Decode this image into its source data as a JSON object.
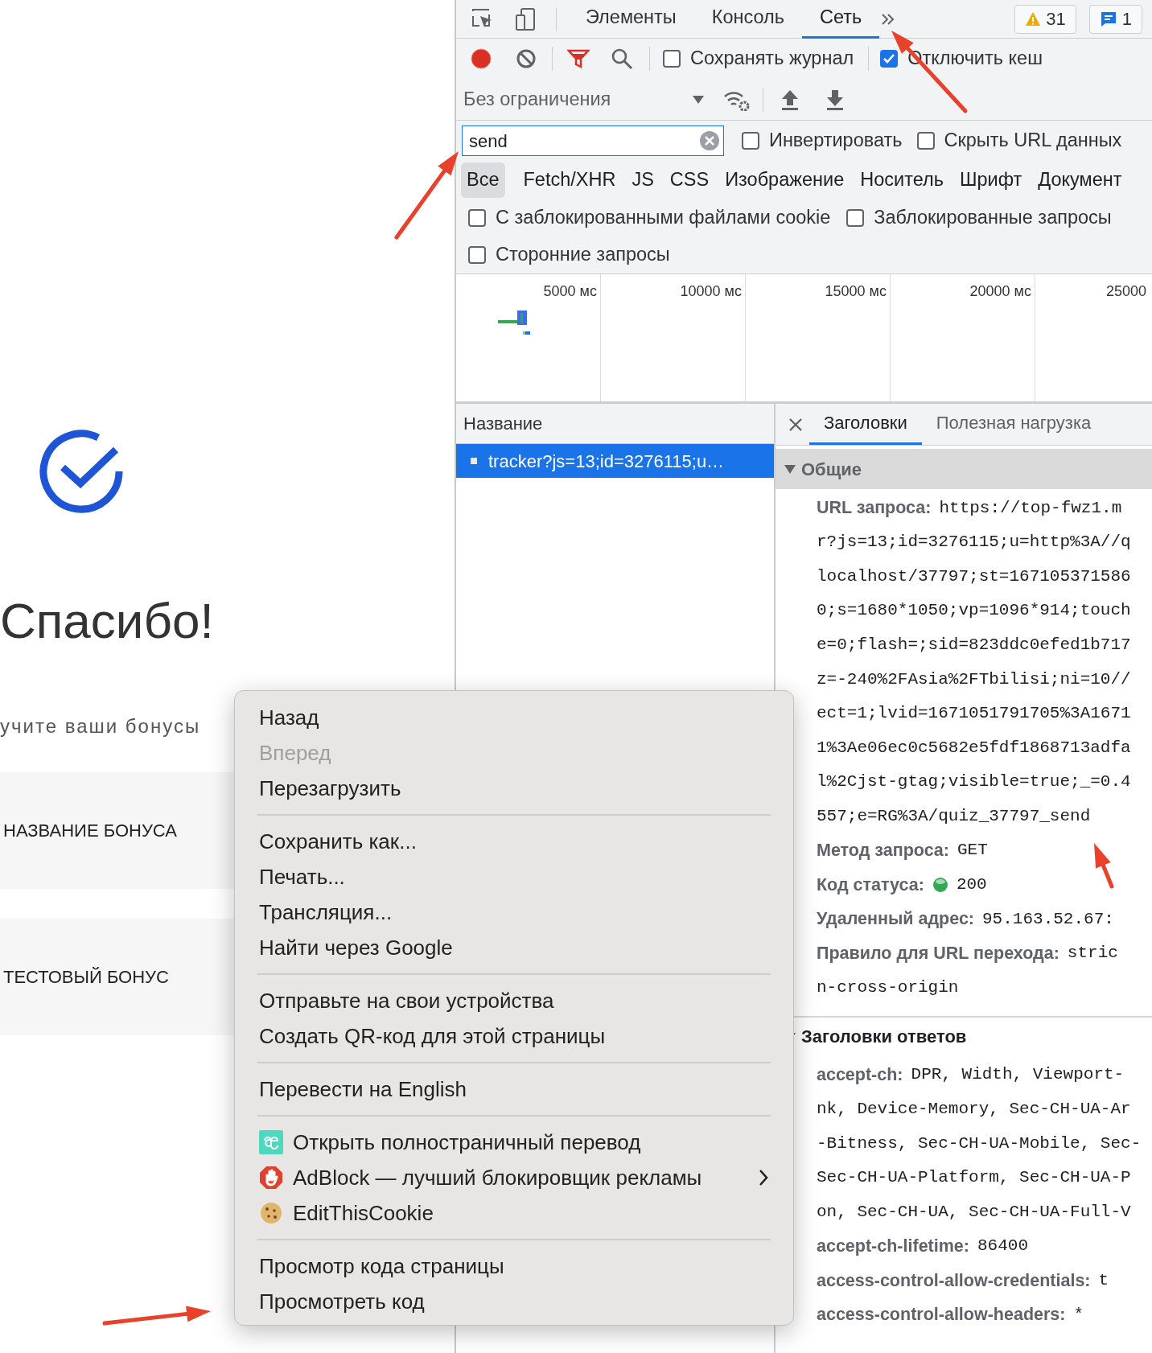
{
  "page": {
    "heading": "Спасибо!",
    "subtitle": "учите ваши бонусы",
    "bonuses": [
      {
        "title": "НАЗВАНИЕ БОНУСА"
      },
      {
        "title": "ТЕСТОВЫЙ БОНУС"
      }
    ]
  },
  "devtools": {
    "tabs": [
      {
        "label": "Элементы",
        "selected": false
      },
      {
        "label": "Консоль",
        "selected": false
      },
      {
        "label": "Сеть",
        "selected": true
      }
    ],
    "warnings_count": "31",
    "messages_count": "1",
    "recording": true,
    "preserve_log": {
      "label": "Сохранять журнал",
      "checked": false
    },
    "disable_cache": {
      "label": "Отключить кеш",
      "checked": true
    },
    "throttling": "Без ограничения",
    "filter": {
      "value": "send"
    },
    "invert": {
      "label": "Инвертировать",
      "checked": false
    },
    "hide_data_urls": {
      "label": "Скрыть URL данных",
      "checked": false
    },
    "type_filters": [
      {
        "label": "Все",
        "selected": true
      },
      {
        "label": "Fetch/XHR",
        "selected": false
      },
      {
        "label": "JS",
        "selected": false
      },
      {
        "label": "CSS",
        "selected": false
      },
      {
        "label": "Изображение",
        "selected": false
      },
      {
        "label": "Носитель",
        "selected": false
      },
      {
        "label": "Шрифт",
        "selected": false
      },
      {
        "label": "Документ",
        "selected": false
      }
    ],
    "options": [
      {
        "label": "С заблокированными файлами cookie",
        "checked": false
      },
      {
        "label": "Заблокированные запросы",
        "checked": false
      },
      {
        "label": "Сторонние запросы",
        "checked": false
      }
    ],
    "timeline": {
      "ticks": [
        "5000 мс",
        "10000 мс",
        "15000 мс",
        "20000 мс",
        "25000"
      ]
    },
    "requests": {
      "column": "Название",
      "rows": [
        {
          "name": "tracker?js=13;id=3276115;u…",
          "selected": true
        }
      ]
    },
    "details": {
      "tabs": [
        {
          "label": "Заголовки",
          "selected": true
        },
        {
          "label": "Полезная нагрузка",
          "selected": false
        }
      ],
      "sections": [
        {
          "title": "Общие",
          "expanded": true,
          "shaded": true,
          "lines": [
            {
              "kind": "field",
              "key": "URL запроса:",
              "value": "https://top-fwz1.m"
            },
            {
              "kind": "wrap",
              "value": "r?js=13;id=3276115;u=http%3A//q"
            },
            {
              "kind": "wrap",
              "value": "localhost/37797;st=167105371586"
            },
            {
              "kind": "wrap",
              "value": "0;s=1680*1050;vp=1096*914;touch"
            },
            {
              "kind": "wrap",
              "value": "e=0;flash=;sid=823ddc0efed1b717"
            },
            {
              "kind": "wrap",
              "value": "z=-240%2FAsia%2FTbilisi;ni=10//"
            },
            {
              "kind": "wrap",
              "value": "ect=1;lvid=1671051791705%3A1671"
            },
            {
              "kind": "wrap",
              "value": "1%3Ae06ec0c5682e5fdf1868713adfa"
            },
            {
              "kind": "wrap",
              "value": "l%2Cjst-gtag;visible=true;_=0.4"
            },
            {
              "kind": "wrap",
              "value": "557;e=RG%3A/quiz_37797_send"
            },
            {
              "kind": "field",
              "key": "Метод запроса:",
              "value": "GET"
            },
            {
              "kind": "status",
              "key": "Код статуса:",
              "value": "200"
            },
            {
              "kind": "field",
              "key": "Удаленный адрес:",
              "value": "95.163.52.67:"
            },
            {
              "kind": "field",
              "key": "Правило для URL перехода:",
              "value": "stric"
            },
            {
              "kind": "wrap",
              "value": "n-cross-origin"
            }
          ]
        },
        {
          "title": "Заголовки ответов",
          "expanded": true,
          "shaded": false,
          "lines": [
            {
              "kind": "field",
              "key": "accept-ch:",
              "value": "DPR, Width, Viewport-"
            },
            {
              "kind": "wrap",
              "value": "nk, Device-Memory, Sec-CH-UA-Ar"
            },
            {
              "kind": "wrap",
              "value": "-Bitness, Sec-CH-UA-Mobile, Sec-"
            },
            {
              "kind": "wrap",
              "value": "Sec-CH-UA-Platform, Sec-CH-UA-P"
            },
            {
              "kind": "wrap",
              "value": "on, Sec-CH-UA, Sec-CH-UA-Full-V"
            },
            {
              "kind": "field",
              "key": "accept-ch-lifetime:",
              "value": "86400"
            },
            {
              "kind": "field",
              "key": "access-control-allow-credentials:",
              "value": "t"
            },
            {
              "kind": "field",
              "key": "access-control-allow-headers:",
              "value": "*"
            }
          ]
        }
      ]
    }
  },
  "context_menu": {
    "items": [
      {
        "kind": "item",
        "label": "Назад",
        "disabled": false
      },
      {
        "kind": "item",
        "label": "Вперед",
        "disabled": true
      },
      {
        "kind": "item",
        "label": "Перезагрузить",
        "disabled": false
      },
      {
        "kind": "separator"
      },
      {
        "kind": "item",
        "label": "Сохранить как...",
        "disabled": false
      },
      {
        "kind": "item",
        "label": "Печать...",
        "disabled": false
      },
      {
        "kind": "item",
        "label": "Трансляция...",
        "disabled": false
      },
      {
        "kind": "item",
        "label": "Найти через Google",
        "disabled": false
      },
      {
        "kind": "separator"
      },
      {
        "kind": "item",
        "label": "Отправьте на свои устройства",
        "disabled": false
      },
      {
        "kind": "item",
        "label": "Создать QR-код для этой страницы",
        "disabled": false
      },
      {
        "kind": "separator"
      },
      {
        "kind": "item",
        "label": "Перевести на English",
        "disabled": false
      },
      {
        "kind": "separator"
      },
      {
        "kind": "extension",
        "label": "Открыть полностраничный перевод",
        "submenu": false
      },
      {
        "kind": "extension",
        "label": "AdBlock — лучший блокировщик рекламы",
        "submenu": true
      },
      {
        "kind": "extension",
        "label": "EditThisCookie",
        "submenu": false
      },
      {
        "kind": "separator"
      },
      {
        "kind": "item",
        "label": "Просмотр кода страницы",
        "disabled": false
      },
      {
        "kind": "item",
        "label": "Просмотреть код",
        "disabled": false
      }
    ]
  }
}
